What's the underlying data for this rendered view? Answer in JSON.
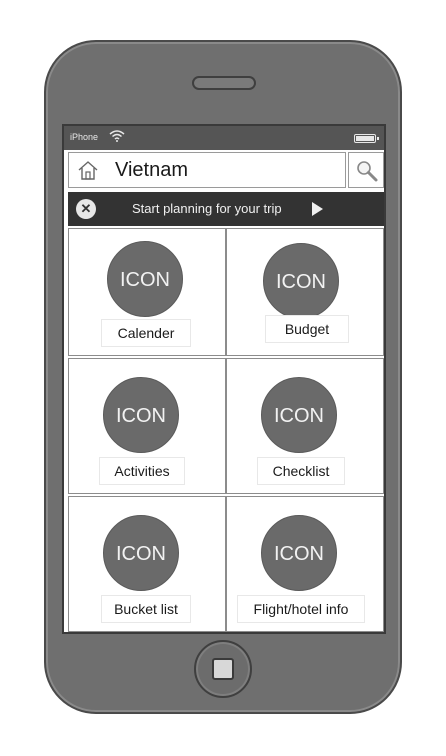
{
  "status_bar": {
    "carrier": "iPhone"
  },
  "header": {
    "title": "Vietnam"
  },
  "banner": {
    "text": "Start planning for your trip",
    "close_glyph": "✕"
  },
  "tiles": [
    {
      "icon_text": "ICON",
      "label": "Calender"
    },
    {
      "icon_text": "ICON",
      "label": "Budget"
    },
    {
      "icon_text": "ICON",
      "label": "Activities"
    },
    {
      "icon_text": "ICON",
      "label": "Checklist"
    },
    {
      "icon_text": "ICON",
      "label": "Bucket list"
    },
    {
      "icon_text": "ICON",
      "label": "Flight/hotel info"
    }
  ],
  "colors": {
    "phone_body": "#6f6f6f",
    "banner_bg": "#333333",
    "icon_circle": "#6a6a6a"
  }
}
